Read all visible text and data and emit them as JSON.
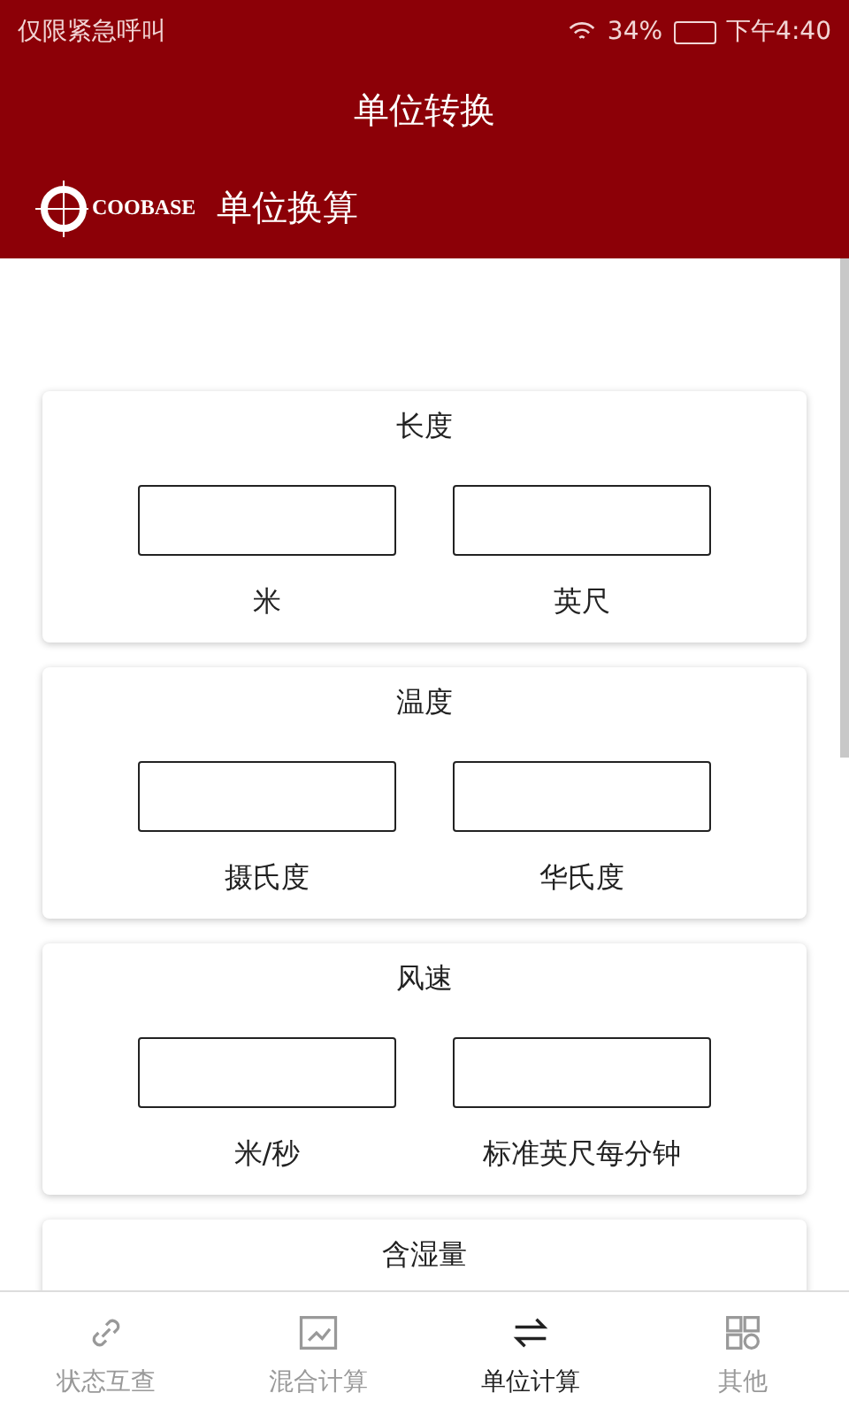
{
  "status_bar": {
    "carrier": "仅限紧急呼叫",
    "battery": "34%",
    "time": "下午4:40"
  },
  "title": "单位转换",
  "header": {
    "logo": "COOBASE",
    "title": "单位换算"
  },
  "cards": [
    {
      "title": "长度",
      "fields": [
        {
          "unit": "米"
        },
        {
          "unit": "英尺"
        }
      ]
    },
    {
      "title": "温度",
      "fields": [
        {
          "unit": "摄氏度"
        },
        {
          "unit": "华氏度"
        }
      ]
    },
    {
      "title": "风速",
      "fields": [
        {
          "unit": "米/秒"
        },
        {
          "unit": "标准英尺每分钟"
        }
      ]
    },
    {
      "title": "含湿量"
    }
  ],
  "tabs": [
    {
      "label": "状态互查",
      "kind": "link",
      "selected": false
    },
    {
      "label": "混合计算",
      "kind": "calc",
      "selected": false
    },
    {
      "label": "单位计算",
      "kind": "swap",
      "selected": true
    },
    {
      "label": "其他",
      "kind": "grid",
      "selected": false
    }
  ]
}
